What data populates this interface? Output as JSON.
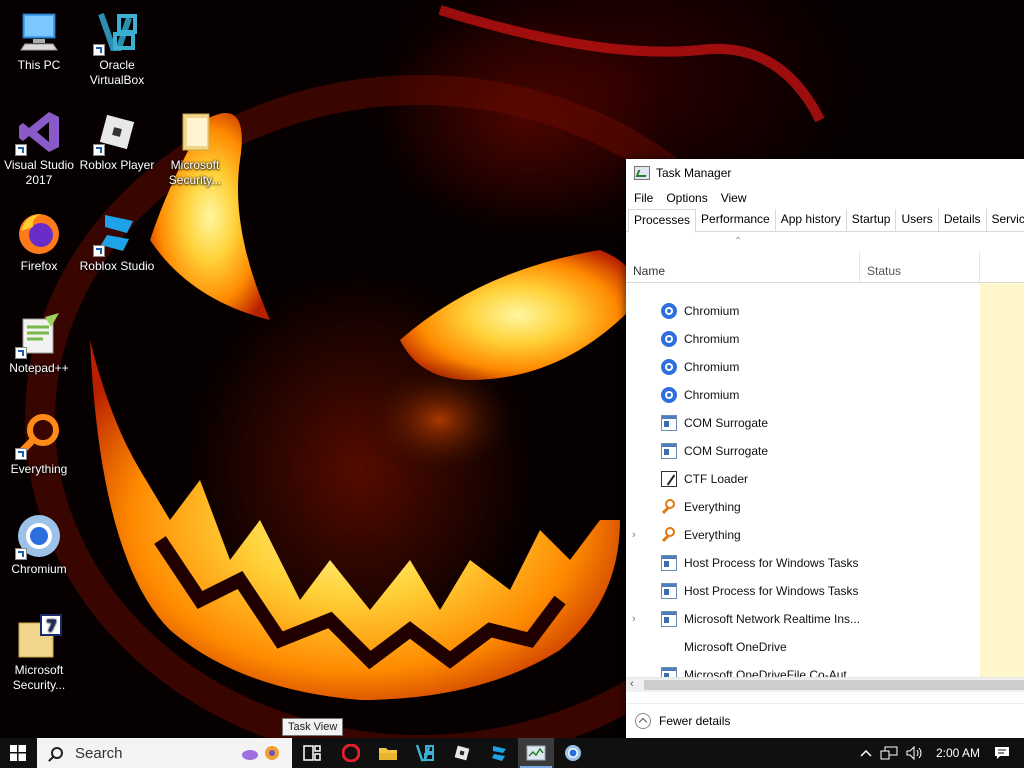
{
  "desktop": {
    "icons": [
      {
        "label_line1": "This PC",
        "label_line2": "",
        "icon": "this-pc-icon"
      },
      {
        "label_line1": "Oracle",
        "label_line2": "VirtualBox",
        "icon": "virtualbox-icon"
      },
      {
        "label_line1": "Visual Studio",
        "label_line2": "2017",
        "icon": "visual-studio-icon"
      },
      {
        "label_line1": "Roblox Player",
        "label_line2": "",
        "icon": "roblox-player-icon"
      },
      {
        "label_line1": "Microsoft",
        "label_line2": "Security...",
        "icon": "folder-icon"
      },
      {
        "label_line1": "Firefox",
        "label_line2": "",
        "icon": "firefox-icon"
      },
      {
        "label_line1": "Roblox Studio",
        "label_line2": "",
        "icon": "roblox-studio-icon"
      },
      {
        "label_line1": "Notepad++",
        "label_line2": "",
        "icon": "notepadpp-icon"
      },
      {
        "label_line1": "Everything",
        "label_line2": "",
        "icon": "everything-icon"
      },
      {
        "label_line1": "Chromium",
        "label_line2": "",
        "icon": "chromium-icon"
      },
      {
        "label_line1": "Microsoft",
        "label_line2": "Security...",
        "icon": "archive-7zip-icon"
      }
    ]
  },
  "task_manager": {
    "title": "Task Manager",
    "menu": [
      "File",
      "Options",
      "View"
    ],
    "tabs": [
      "Processes",
      "Performance",
      "App history",
      "Startup",
      "Users",
      "Details",
      "Services"
    ],
    "active_tab": "Processes",
    "columns": {
      "name": "Name",
      "status": "Status"
    },
    "processes": [
      {
        "name": "Chromium",
        "icon": "chromium-icon",
        "expandable": false
      },
      {
        "name": "Chromium",
        "icon": "chromium-icon",
        "expandable": false
      },
      {
        "name": "Chromium",
        "icon": "chromium-icon",
        "expandable": false
      },
      {
        "name": "Chromium",
        "icon": "chromium-icon",
        "expandable": false
      },
      {
        "name": "COM Surrogate",
        "icon": "window-icon",
        "expandable": false
      },
      {
        "name": "COM Surrogate",
        "icon": "window-icon",
        "expandable": false
      },
      {
        "name": "CTF Loader",
        "icon": "pen-icon",
        "expandable": false
      },
      {
        "name": "Everything",
        "icon": "everything-icon",
        "expandable": false
      },
      {
        "name": "Everything",
        "icon": "everything-icon",
        "expandable": true
      },
      {
        "name": "Host Process for Windows Tasks",
        "icon": "window-icon",
        "expandable": false
      },
      {
        "name": "Host Process for Windows Tasks",
        "icon": "window-icon",
        "expandable": false
      },
      {
        "name": "Microsoft Network Realtime Ins...",
        "icon": "window-icon",
        "expandable": true
      },
      {
        "name": "Microsoft OneDrive",
        "icon": "none",
        "expandable": false
      },
      {
        "name": "Microsoft OneDriveFile Co-Aut...",
        "icon": "window-icon",
        "expandable": false
      }
    ],
    "footer": "Fewer details"
  },
  "tooltip": "Task View",
  "taskbar": {
    "search_placeholder": "Search",
    "clock": "2:00 AM",
    "pinned": [
      "task-view",
      "opera",
      "file-explorer",
      "virtualbox",
      "roblox-player",
      "roblox-studio",
      "task-manager",
      "chromium"
    ],
    "active": "task-manager"
  },
  "colors": {
    "taskbar_bg": "#101010",
    "accent": "#0078d7",
    "status_column_bg": "#fff6cc"
  }
}
